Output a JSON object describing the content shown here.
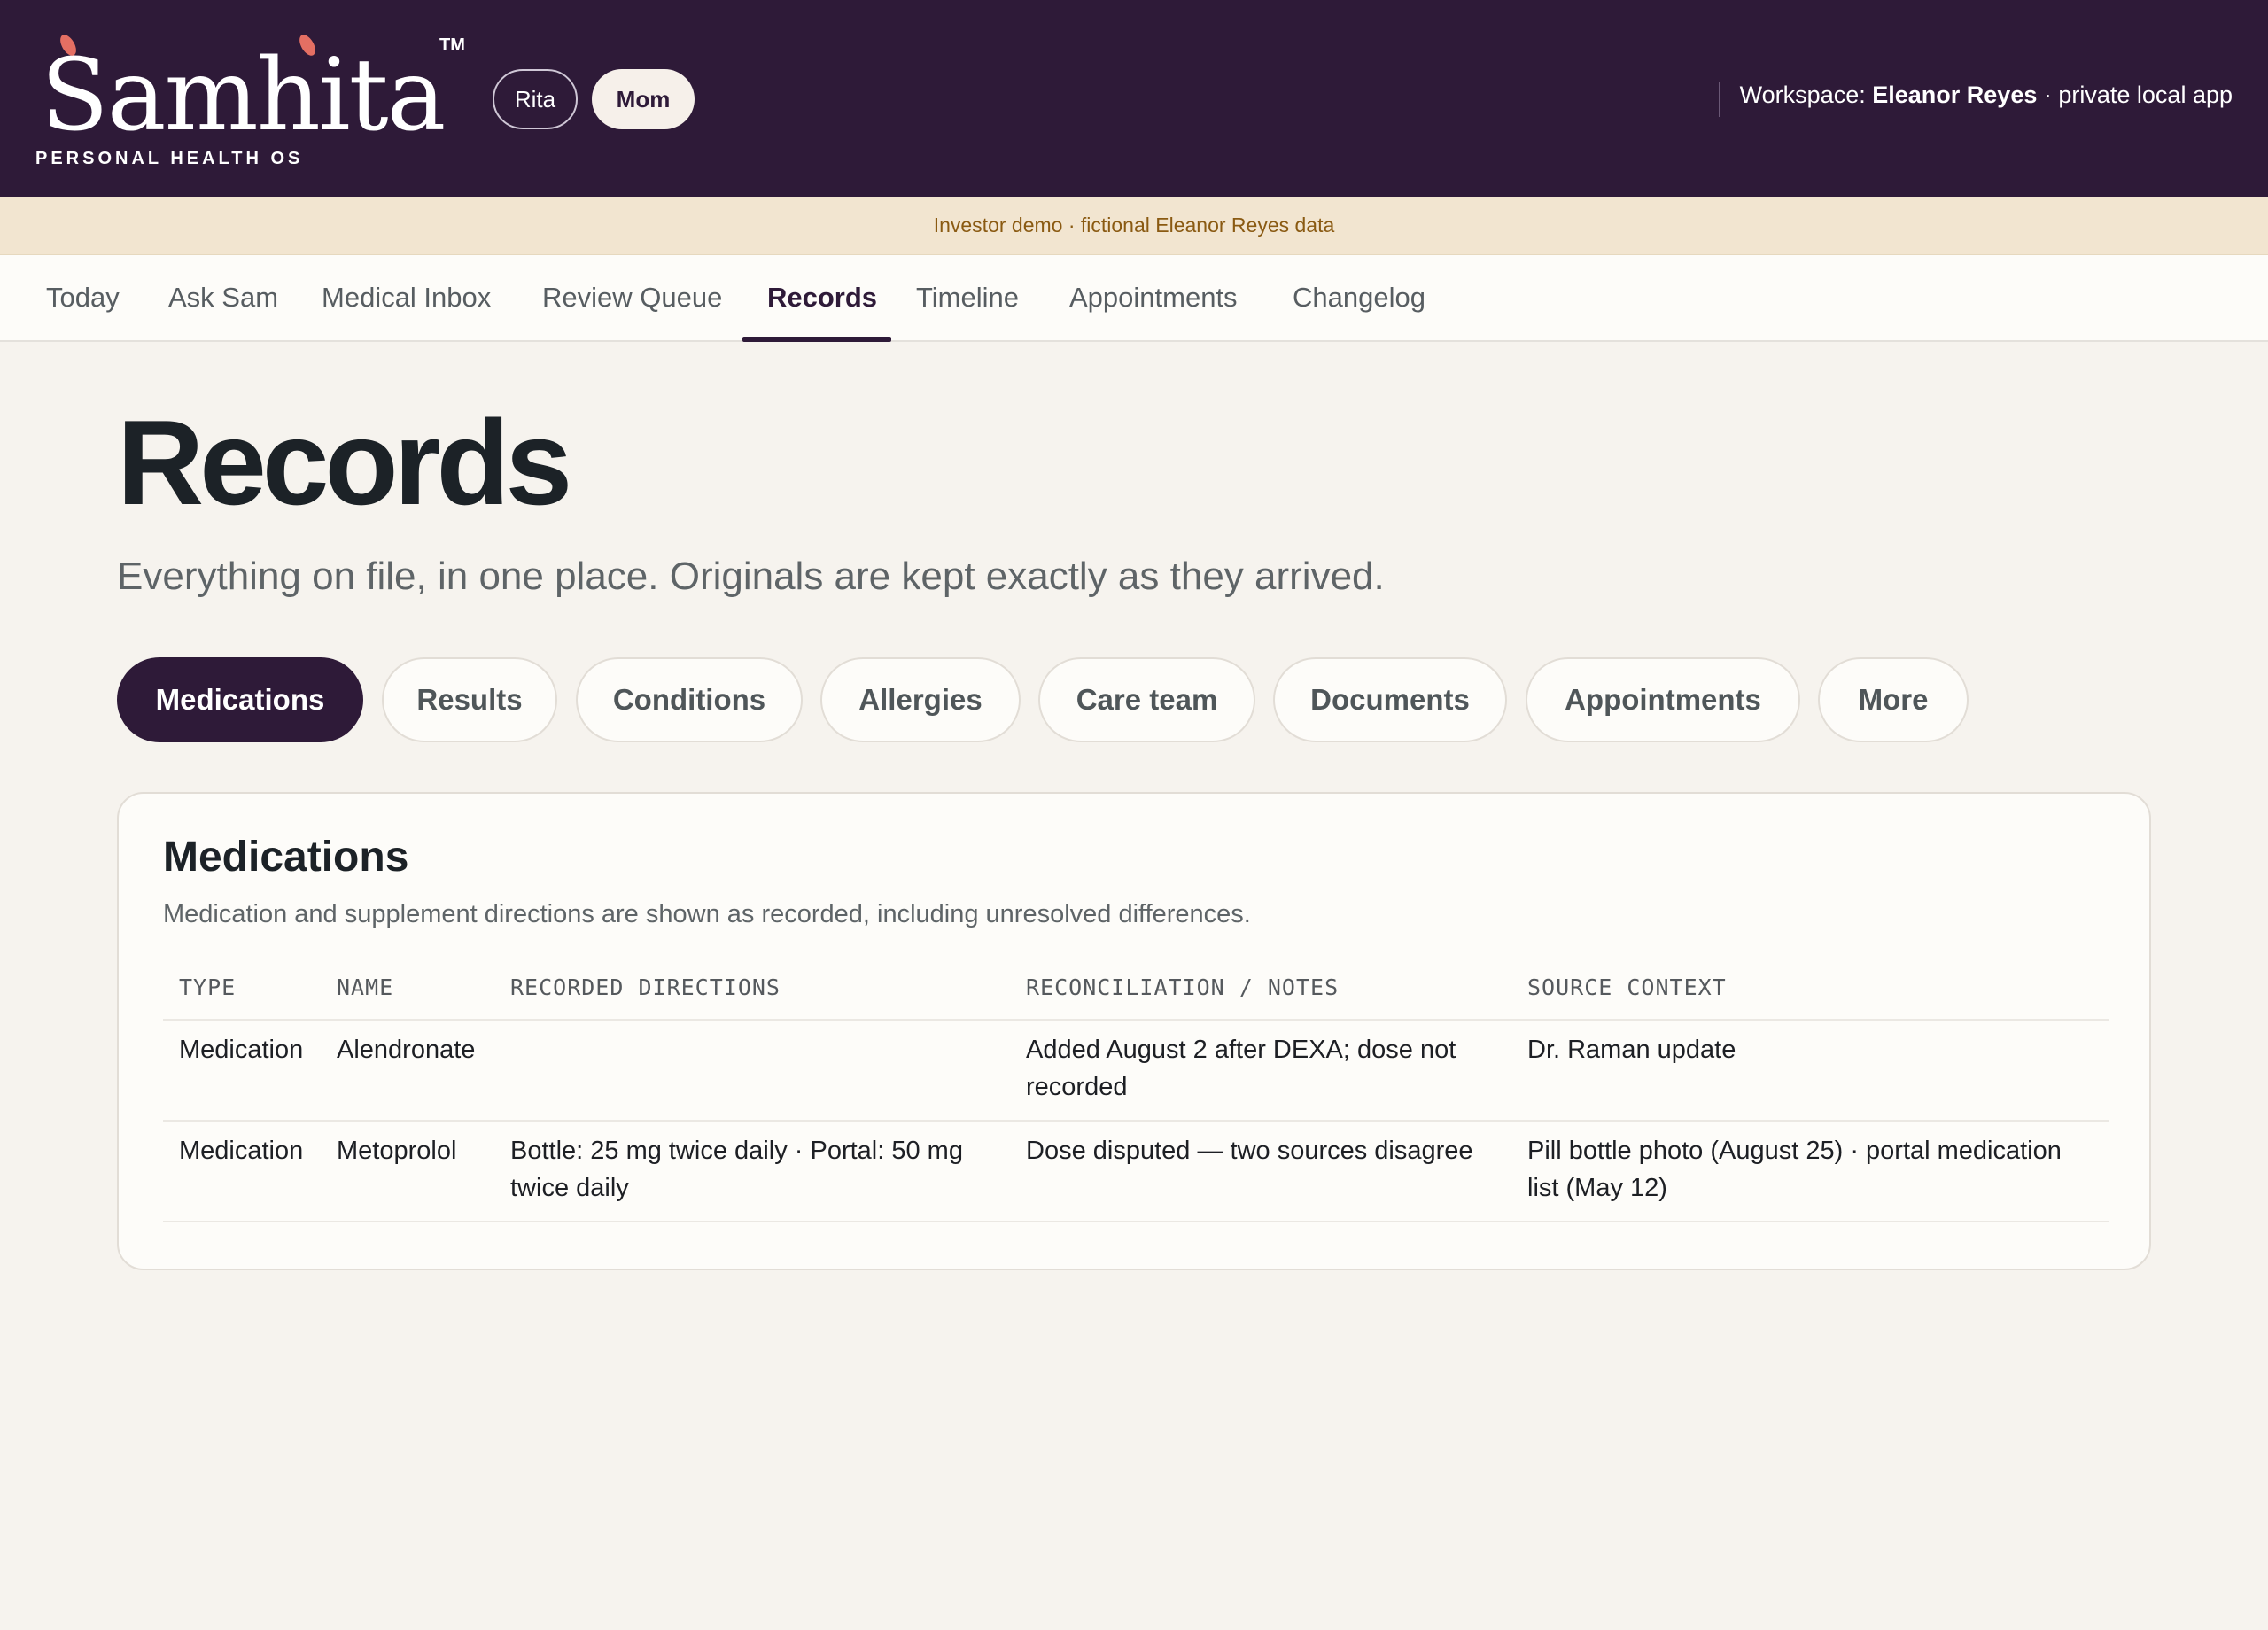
{
  "header": {
    "brand": "Samhita",
    "trademark": "TM",
    "tagline": "PERSONAL HEALTH OS",
    "profiles": [
      "Rita",
      "Mom"
    ],
    "active_profile": "Mom",
    "workspace_label": "Workspace:",
    "workspace_name": "Eleanor Reyes",
    "workspace_suffix": "· private local app",
    "colors": {
      "primary": "#2e1a38",
      "accent": "#e46f63"
    }
  },
  "banner": {
    "text": "Investor demo · fictional Eleanor Reyes data"
  },
  "nav": {
    "items": [
      "Today",
      "Ask Sam",
      "Medical Inbox",
      "Review Queue",
      "Records",
      "Timeline",
      "Appointments",
      "Changelog"
    ],
    "active": "Records"
  },
  "page": {
    "title": "Records",
    "subtitle": "Everything on file, in one place. Originals are kept exactly as they arrived."
  },
  "filters": {
    "chips": [
      "Medications",
      "Results",
      "Conditions",
      "Allergies",
      "Care team",
      "Documents",
      "Appointments",
      "More"
    ],
    "active": "Medications"
  },
  "card": {
    "title": "Medications",
    "description": "Medication and supplement directions are shown as recorded, including unresolved differences.",
    "columns": [
      "TYPE",
      "NAME",
      "RECORDED DIRECTIONS",
      "RECONCILIATION / NOTES",
      "SOURCE CONTEXT"
    ],
    "rows": [
      {
        "type": "Medication",
        "name": "Alendronate",
        "directions": "",
        "notes": "Added August 2 after DEXA; dose not recorded",
        "source": "Dr. Raman update"
      },
      {
        "type": "Medication",
        "name": "Metoprolol",
        "directions": "Bottle: 25 mg twice daily · Portal: 50 mg twice daily",
        "notes": "Dose disputed — two sources disagree",
        "source": "Pill bottle photo (August 25) · portal medication list (May 12)"
      }
    ]
  }
}
